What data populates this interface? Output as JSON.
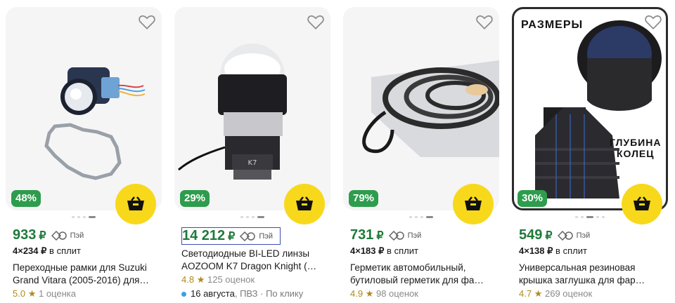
{
  "products": [
    {
      "discount": "48%",
      "price": "933",
      "currency": "₽",
      "pay_label": "Пэй",
      "split_amount": "4×234",
      "split_currency": "₽",
      "split_label": "в сплит",
      "title_line1": "Переходные рамки для Suzuki",
      "title_line2": "Grand Vitara (2005-2016) для…",
      "rating": "5.0",
      "star": "★",
      "reviews": "1 оценка"
    },
    {
      "discount": "29%",
      "price": "14 212",
      "currency": "₽",
      "pay_label": "Пэй",
      "title_line1": "Светодиодные BI-LED линзы",
      "title_line2": "AOZOOM K7 Dragon Knight (…",
      "rating": "4.8",
      "star": "★",
      "reviews": "125 оценок",
      "delivery_date": "16 августа",
      "delivery_point": ", ПВЗ",
      "delivery_extra": " · По клику",
      "lens_label": "K7"
    },
    {
      "discount": "79%",
      "price": "731",
      "currency": "₽",
      "pay_label": "Пэй",
      "split_amount": "4×183",
      "split_currency": "₽",
      "split_label": "в сплит",
      "title_line1": "Герметик автомобильный,",
      "title_line2": "бутиловый герметик для фа…",
      "rating": "4.9",
      "star": "★",
      "reviews": "98 оценок"
    },
    {
      "discount": "30%",
      "price": "549",
      "currency": "₽",
      "pay_label": "Пэй",
      "split_amount": "4×138",
      "split_currency": "₽",
      "split_label": "в сплит",
      "title_line1": "Универсальная резиновая",
      "title_line2": "крышка заглушка для фар…",
      "rating": "4.7",
      "star": "★",
      "reviews": "269 оценок",
      "image_title": "РАЗМЕРЫ",
      "image_depth_line1": "ГЛУБИНА",
      "image_depth_line2": "КОЛЕЦ"
    }
  ],
  "colors": {
    "discount_bg": "#2e9c4d",
    "price": "#1f7a3a",
    "cart_button": "#f8d81b",
    "rating": "#b08a1e"
  },
  "icons": [
    "heart-icon",
    "cart-icon",
    "split-pay-icon",
    "star-icon"
  ]
}
